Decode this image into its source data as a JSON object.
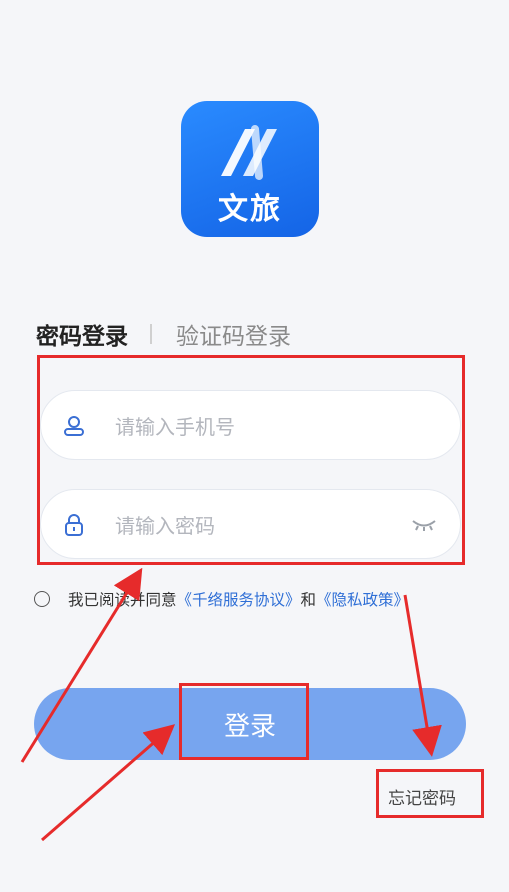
{
  "logo": {
    "text": "文旅"
  },
  "tabs": {
    "active": "密码登录",
    "inactive": "验证码登录"
  },
  "phone": {
    "placeholder": "请输入手机号"
  },
  "password": {
    "placeholder": "请输入密码"
  },
  "agreement": {
    "prefix": "我已阅读并同意",
    "service_link": "《千络服务协议》",
    "and": "和",
    "privacy_link": "《隐私政策》"
  },
  "login_button": "登录",
  "forgot_password": "忘记密码",
  "colors": {
    "primary": "#77a5ef",
    "link": "#2f6fd6",
    "annotation": "#e62b2b"
  }
}
